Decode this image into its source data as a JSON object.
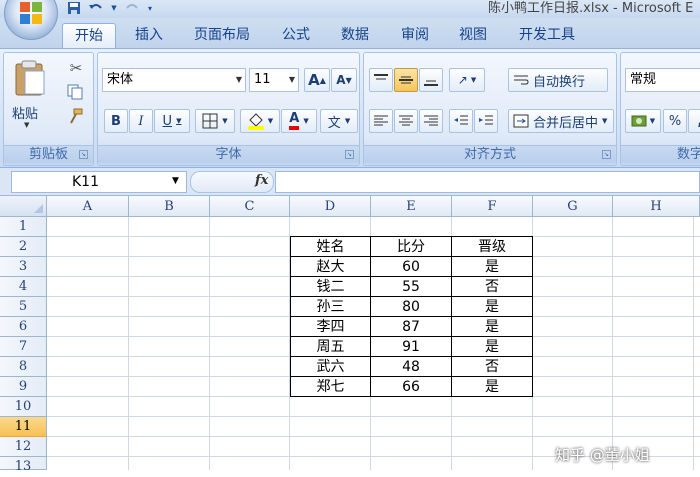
{
  "app": {
    "doc_title": "陈小鸭工作日报.xlsx - Microsoft E"
  },
  "tabs": [
    {
      "label": "开始",
      "active": true
    },
    {
      "label": "插入"
    },
    {
      "label": "页面布局"
    },
    {
      "label": "公式"
    },
    {
      "label": "数据"
    },
    {
      "label": "审阅"
    },
    {
      "label": "视图"
    },
    {
      "label": "开发工具"
    }
  ],
  "ribbon": {
    "clipboard": {
      "label": "剪贴板",
      "paste_label": "粘贴"
    },
    "font": {
      "label": "字体",
      "font_name": "宋体",
      "font_size": "11",
      "grow_label": "A",
      "shrink_label": "A",
      "bold": "B",
      "italic": "I",
      "underline": "U",
      "font_color_glyph": "A",
      "phonetic_glyph": "文"
    },
    "alignment": {
      "label": "对齐方式",
      "wrap_text": "自动换行",
      "merge_center": "合并后居中"
    },
    "number": {
      "label": "数字",
      "format": "常规",
      "percent": "%",
      "comma": ","
    }
  },
  "formula_bar": {
    "name_box": "K11",
    "fx": "fx",
    "formula": ""
  },
  "sheet": {
    "columns": [
      "A",
      "B",
      "C",
      "D",
      "E",
      "F",
      "G",
      "H"
    ],
    "rows": [
      "1",
      "2",
      "3",
      "4",
      "5",
      "6",
      "7",
      "8",
      "9",
      "10",
      "11",
      "12",
      "13"
    ],
    "selected_row": "11",
    "table": {
      "headers": [
        "姓名",
        "比分",
        "晋级"
      ],
      "rows": [
        [
          "赵大",
          "60",
          "是"
        ],
        [
          "钱二",
          "55",
          "否"
        ],
        [
          "孙三",
          "80",
          "是"
        ],
        [
          "李四",
          "87",
          "是"
        ],
        [
          "周五",
          "91",
          "是"
        ],
        [
          "武六",
          "48",
          "否"
        ],
        [
          "郑七",
          "66",
          "是"
        ]
      ]
    }
  },
  "watermark": "知乎 @董小姐",
  "colors": {
    "accent": "#15428b",
    "ribbon_bg": "#d6e4f5",
    "selected_row": "#f7c153"
  }
}
